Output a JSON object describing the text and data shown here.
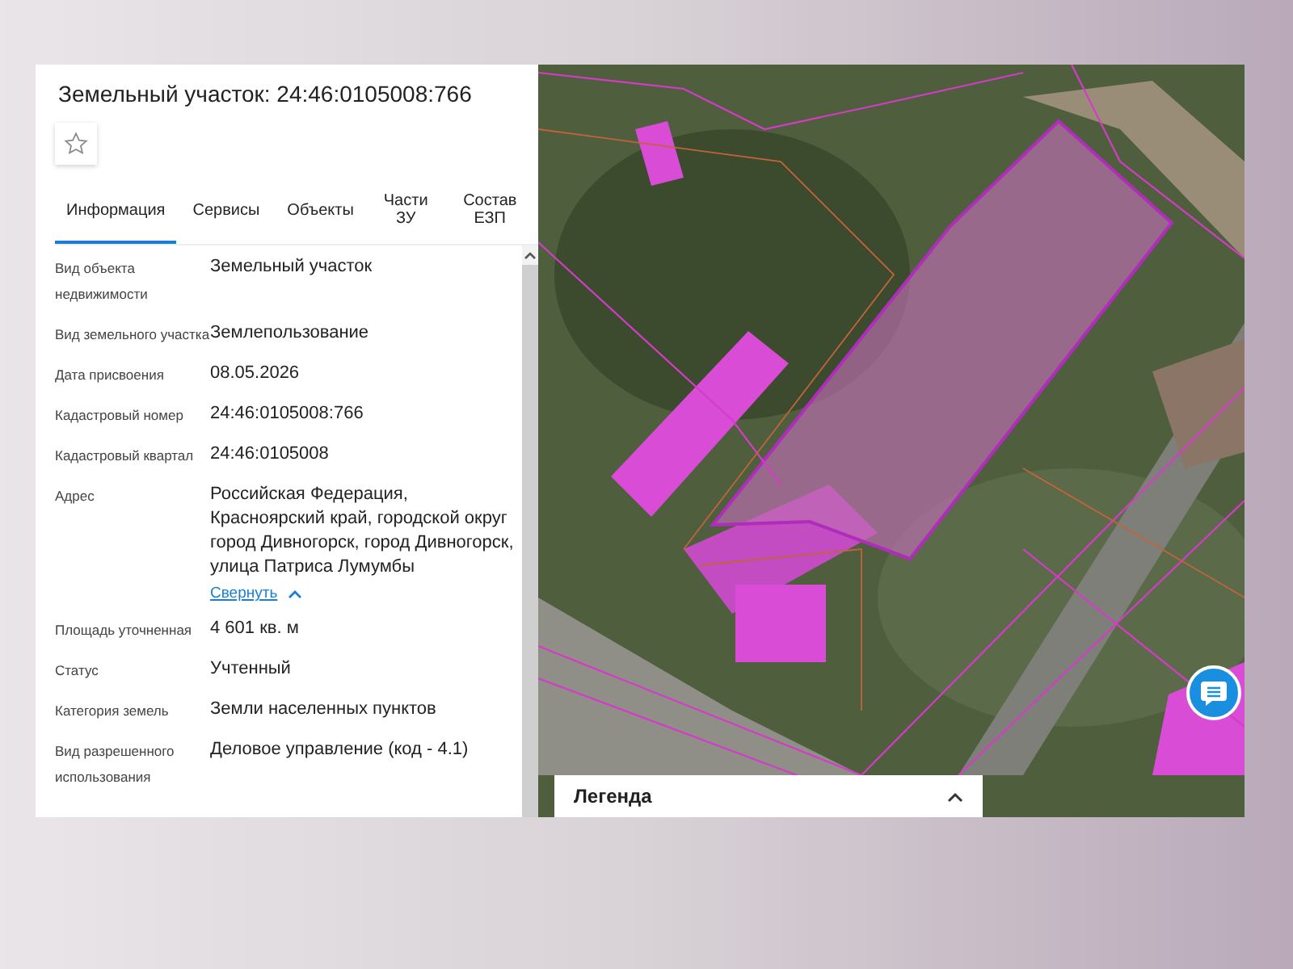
{
  "panel": {
    "title": "Земельный участок: 24:46:0105008:766",
    "favorite": {
      "on": false
    },
    "tabs": [
      {
        "label": "Информация",
        "selected": true
      },
      {
        "label": "Сервисы",
        "selected": false
      },
      {
        "label": "Объекты",
        "selected": false
      },
      {
        "label": "Части ЗУ",
        "selected": false
      },
      {
        "label": "Состав ЕЗП",
        "selected": false
      }
    ],
    "fields": [
      {
        "label": "Вид объекта недвижимости",
        "value": "Земельный участок"
      },
      {
        "label": "Вид земельного участка",
        "value": "Землепользование"
      },
      {
        "label": "Дата присвоения",
        "value": "08.05.2026"
      },
      {
        "label": "Кадастровый номер",
        "value": "24:46:0105008:766"
      },
      {
        "label": "Кадастровый квартал",
        "value": "24:46:0105008"
      },
      {
        "label": "Адрес",
        "value": "Российская Федерация, Красноярский край, городской округ город Дивногорск, город Дивногорск, улица Патриса Лумумбы",
        "toggle": "Свернуть"
      },
      {
        "label": "Площадь уточненная",
        "value": "4 601 кв. м"
      },
      {
        "label": "Статус",
        "value": "Учтенный"
      },
      {
        "label": "Категория земель",
        "value": "Земли населенных пунктов"
      },
      {
        "label": "Вид разрешенного использования",
        "value": "Деловое управление (код - 4.1)"
      }
    ]
  },
  "map": {
    "legend": {
      "title": "Легенда",
      "expanded": false
    }
  }
}
